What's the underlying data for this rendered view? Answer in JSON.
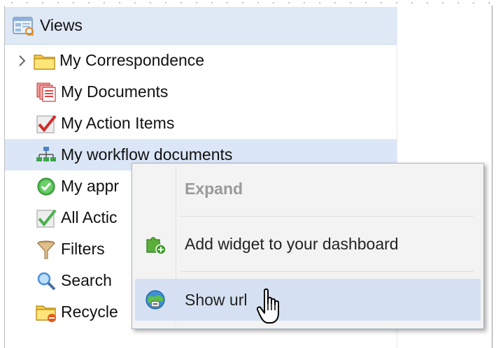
{
  "panel": {
    "title": "Views",
    "title_icon": "views-icon",
    "items": [
      {
        "label": "My Correspondence",
        "icon": "folder-icon",
        "expandable": true
      },
      {
        "label": "My Documents",
        "icon": "documents-icon"
      },
      {
        "label": "My Action Items",
        "icon": "checkmark-icon"
      },
      {
        "label": "My workflow documents",
        "icon": "workflow-icon",
        "selected": true
      },
      {
        "label": "My appr",
        "icon": "approve-circle-icon"
      },
      {
        "label": "All Actic",
        "icon": "check-box-icon"
      },
      {
        "label": "Filters",
        "icon": "funnel-icon"
      },
      {
        "label": "Search",
        "icon": "magnifier-icon"
      },
      {
        "label": "Recycle",
        "icon": "recycle-folder-icon"
      }
    ]
  },
  "context_menu": {
    "items": [
      {
        "label": "Expand",
        "disabled": true,
        "icon": ""
      },
      {
        "label": "Add widget to your dashboard",
        "icon": "puzzle-add-icon"
      },
      {
        "label": "Show url",
        "icon": "globe-link-icon",
        "hover": true
      }
    ]
  },
  "colors": {
    "header_bg": "#dfe8f5",
    "selected_bg": "#dbe7f7",
    "menu_bg": "#f3f3f3",
    "menu_hover_bg": "#d5e1f2"
  }
}
